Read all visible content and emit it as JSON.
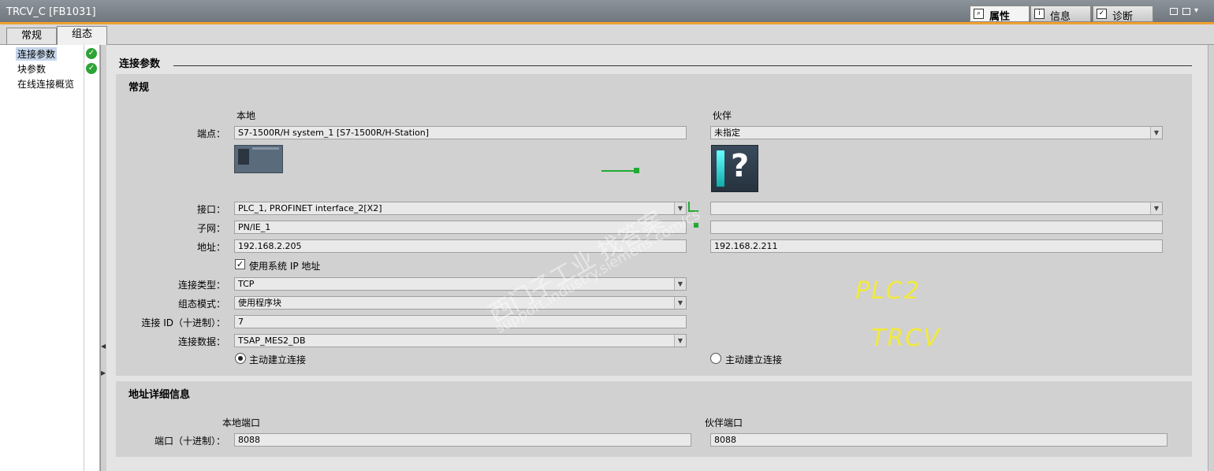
{
  "window": {
    "title": "TRCV_C [FB1031]"
  },
  "top_tabs": [
    {
      "label": "属性",
      "icon": "properties-icon",
      "active": true
    },
    {
      "label": "信息",
      "icon": "info-icon",
      "active": false
    },
    {
      "label": "诊断",
      "icon": "diagnostics-icon",
      "active": false
    }
  ],
  "sub_tabs": [
    {
      "label": "常规",
      "active": false
    },
    {
      "label": "组态",
      "active": true
    }
  ],
  "nav": {
    "items": [
      {
        "label": "连接参数",
        "selected": true,
        "ok": true
      },
      {
        "label": "块参数",
        "selected": false,
        "ok": true
      },
      {
        "label": "在线连接概览",
        "selected": false,
        "ok": false
      }
    ]
  },
  "section_title": "连接参数",
  "general": {
    "title": "常规",
    "local_header": "本地",
    "partner_header": "伙伴",
    "endpoint_label": "端点：",
    "endpoint_local": "S7-1500R/H system_1 [S7-1500R/H-Station]",
    "endpoint_partner": "未指定",
    "interface_label": "接口：",
    "interface_local": "PLC_1, PROFINET interface_2[X2]",
    "interface_partner": "",
    "subnet_label": "子网：",
    "subnet_local": "PN/IE_1",
    "subnet_partner": "",
    "address_label": "地址：",
    "address_local": "192.168.2.205",
    "address_partner": "192.168.2.211",
    "use_system_ip_label": "使用系统 IP 地址",
    "use_system_ip_checked": true,
    "conn_type_label": "连接类型：",
    "conn_type_value": "TCP",
    "config_mode_label": "组态模式：",
    "config_mode_value": "使用程序块",
    "conn_id_label": "连接 ID（十进制）：",
    "conn_id_value": "7",
    "conn_data_label": "连接数据：",
    "conn_data_value": "TSAP_MES2_DB",
    "active_conn_local_label": "主动建立连接",
    "active_conn_local_checked": true,
    "active_conn_partner_label": "主动建立连接",
    "active_conn_partner_checked": false
  },
  "address_details": {
    "title": "地址详细信息",
    "local_port_header": "本地端口",
    "partner_port_header": "伙伴端口",
    "port_label": "端口（十进制）：",
    "local_port": "8088",
    "partner_port": "8088"
  },
  "annotations": {
    "line1": "PLC2",
    "line2": "TRCV"
  },
  "watermark": {
    "cn": "西门子工业 找答案",
    "url": "support.industry.siemens.com/cs"
  },
  "colors": {
    "accent_orange": "#f0a030",
    "ok_green": "#2ea336",
    "handwriting_yellow": "#f2e93c"
  }
}
